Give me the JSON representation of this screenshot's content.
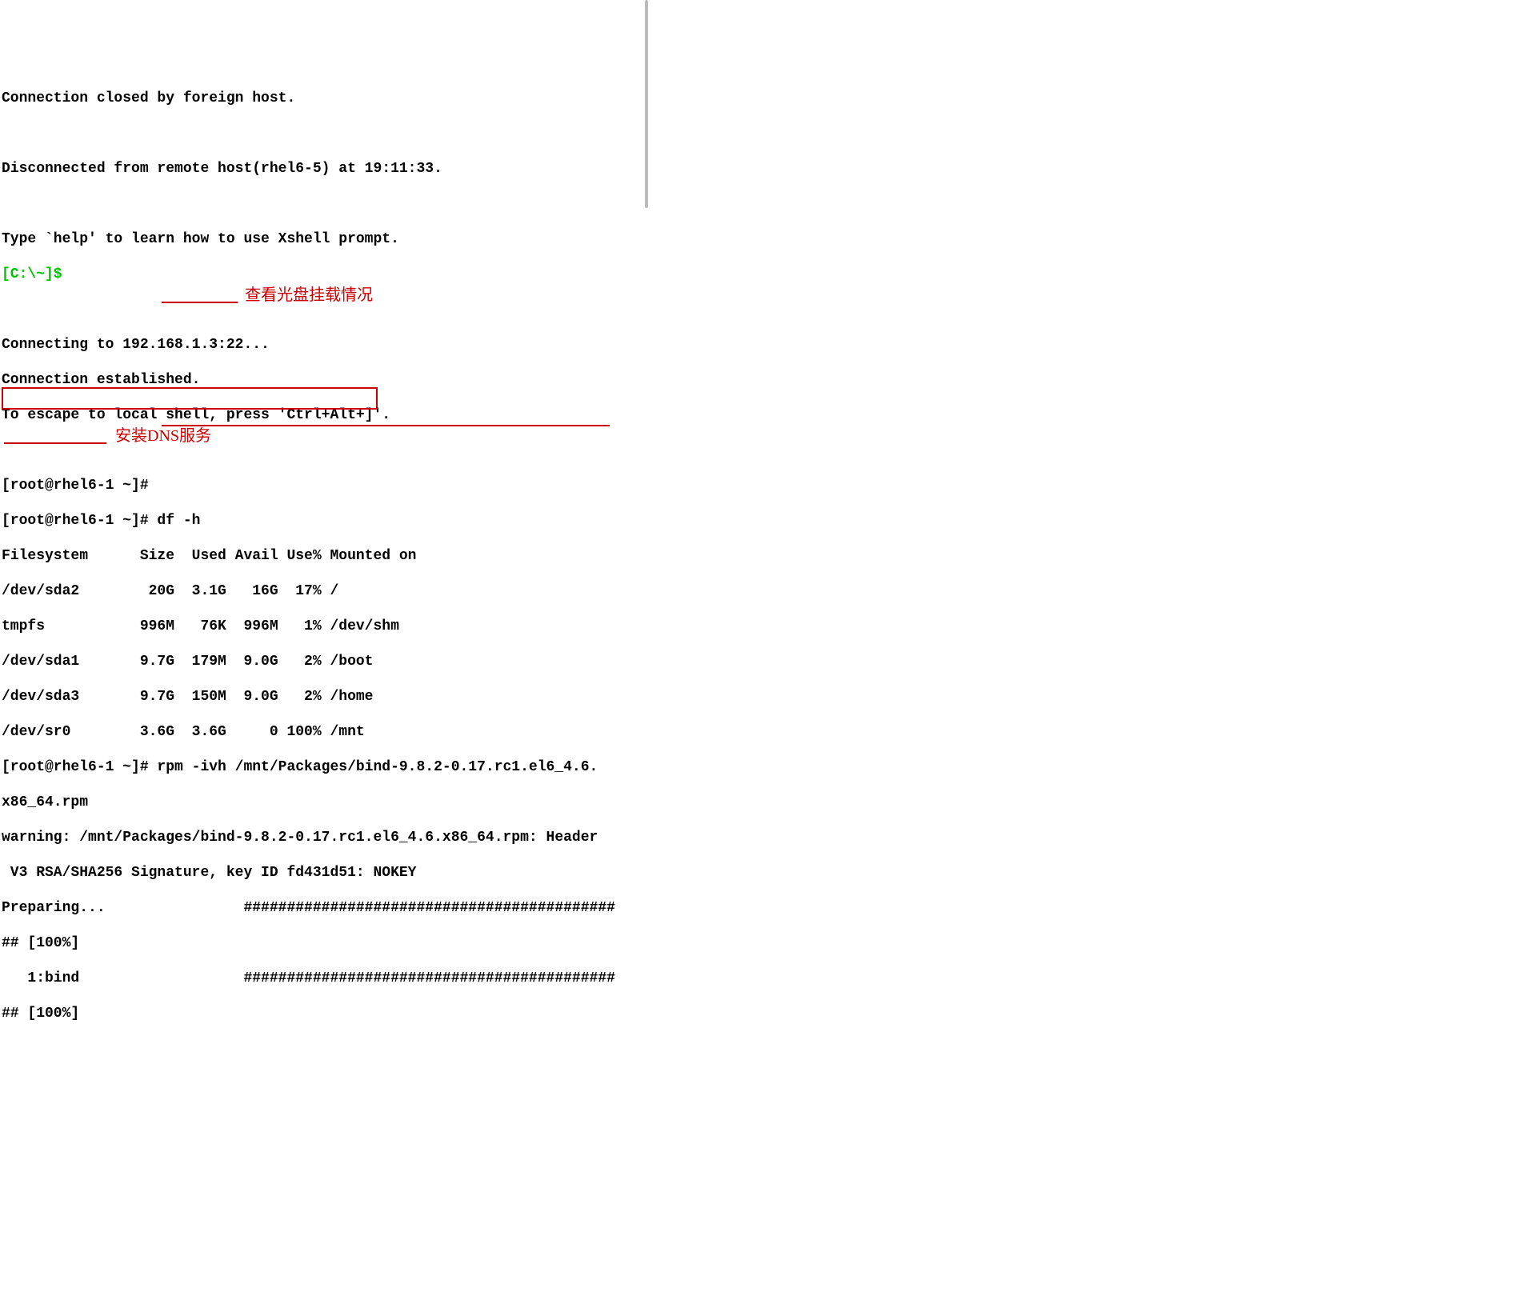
{
  "lines": {
    "l1": "Connection closed by foreign host.",
    "l2": "",
    "l3": "Disconnected from remote host(rhel6-5) at 19:11:33.",
    "l4": "",
    "l5": "Type `help' to learn how to use Xshell prompt.",
    "l6": "[C:\\~]$",
    "l7": "",
    "l8": "Connecting to 192.168.1.3:22...",
    "l9": "Connection established.",
    "l10": "To escape to local shell, press 'Ctrl+Alt+]'.",
    "l11": "",
    "l12": "[root@rhel6-1 ~]#",
    "l13": "[root@rhel6-1 ~]# df -h",
    "l14": "Filesystem      Size  Used Avail Use% Mounted on",
    "l15": "/dev/sda2        20G  3.1G   16G  17% /",
    "l16": "tmpfs           996M   76K  996M   1% /dev/shm",
    "l17": "/dev/sda1       9.7G  179M  9.0G   2% /boot",
    "l18": "/dev/sda3       9.7G  150M  9.0G   2% /home",
    "l19": "/dev/sr0        3.6G  3.6G     0 100% /mnt",
    "l20": "[root@rhel6-1 ~]# rpm -ivh /mnt/Packages/bind-9.8.2-0.17.rc1.el6_4.6.",
    "l21": "x86_64.rpm",
    "l22": "warning: /mnt/Packages/bind-9.8.2-0.17.rc1.el6_4.6.x86_64.rpm: Header",
    "l23": " V3 RSA/SHA256 Signature, key ID fd431d51: NOKEY",
    "l24": "Preparing...                ###########################################",
    "l25": "## [100%]",
    "l26": "   1:bind                   ###########################################",
    "l27": "## [100%]"
  },
  "annotations": {
    "a1": "查看光盘挂载情况",
    "a2": "安装DNS服务"
  }
}
